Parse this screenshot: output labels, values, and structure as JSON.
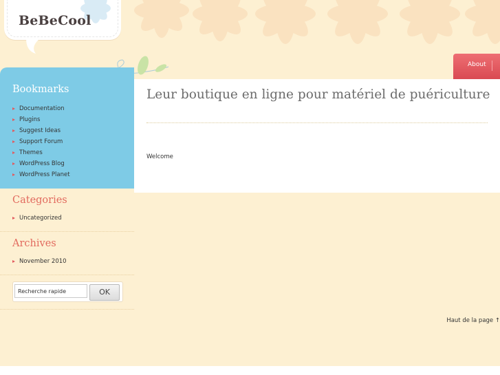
{
  "site": {
    "title": "BeBeCool"
  },
  "nav": {
    "items": [
      {
        "label": "About"
      }
    ]
  },
  "post": {
    "title": "Leur boutique en ligne pour matériel de puériculture",
    "body": "Welcome"
  },
  "sidebar": {
    "bookmarks": {
      "title": "Bookmarks",
      "items": [
        "Documentation",
        "Plugins",
        "Suggest Ideas",
        "Support Forum",
        "Themes",
        "WordPress Blog",
        "WordPress Planet"
      ]
    },
    "categories": {
      "title": "Categories",
      "items": [
        "Uncategorized"
      ]
    },
    "archives": {
      "title": "Archives",
      "items": [
        "November 2010"
      ]
    },
    "search": {
      "placeholder": "Recherche rapide",
      "button_label": "OK"
    }
  },
  "footer": {
    "back_to_top": "Haut de la page ↑"
  },
  "colors": {
    "background": "#fdf0d2",
    "sidebar_blue": "#7ecbe6",
    "nav_red": "#e25a5e",
    "widget_title": "#e26a5e"
  }
}
